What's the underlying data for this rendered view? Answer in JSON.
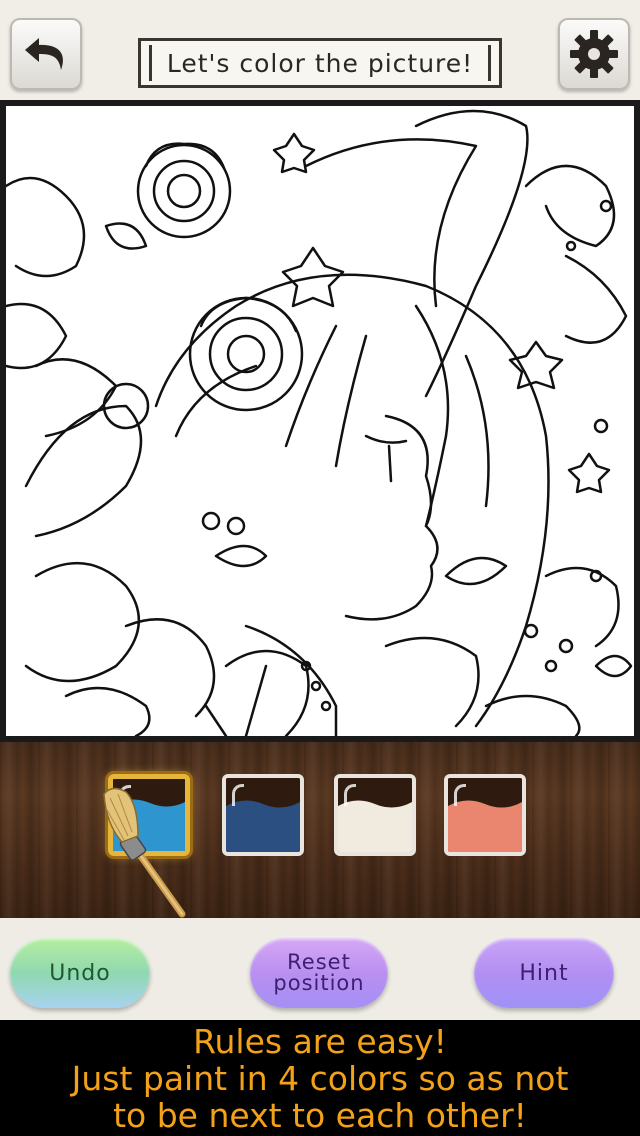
{
  "header": {
    "title": "Let's color the picture!",
    "back_icon": "undo-arrow-icon",
    "settings_icon": "gear-icon"
  },
  "palette": {
    "colors": [
      "#2f95cf",
      "#2b4f80",
      "#f1ebdf",
      "#ea8670"
    ],
    "selected_index": 0,
    "brush_icon": "paintbrush-icon"
  },
  "buttons": {
    "undo": "Undo",
    "reset_line1": "Reset",
    "reset_line2": "position",
    "hint": "Hint"
  },
  "instruction": {
    "line1": "Rules are easy!",
    "line2": "Just paint in 4 colors so as not",
    "line3": "to be next to each other!"
  }
}
